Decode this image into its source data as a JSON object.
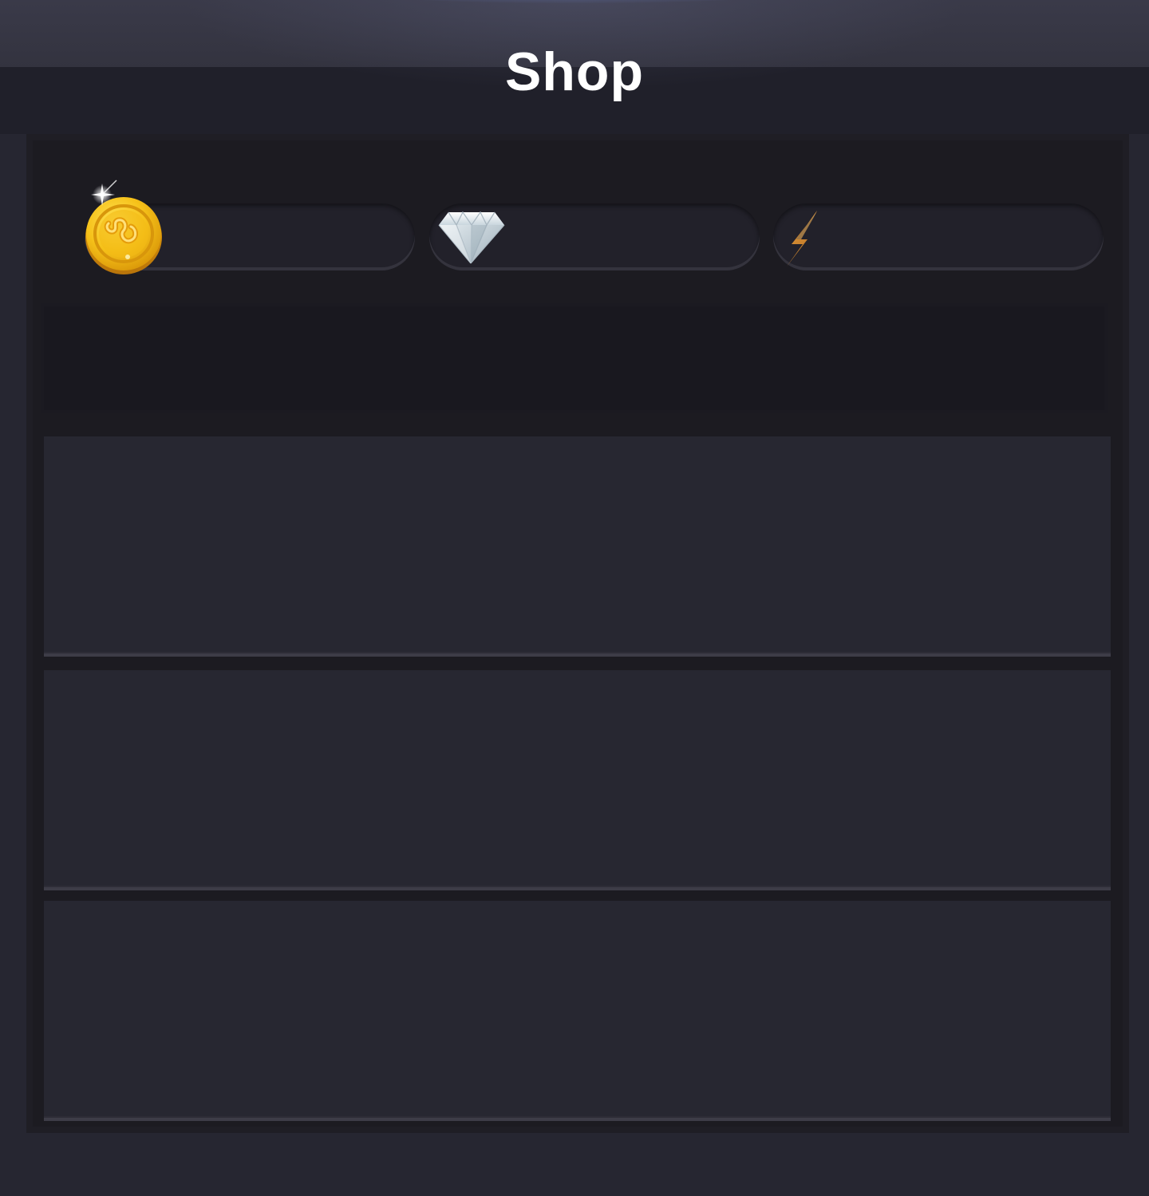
{
  "header": {
    "title": "Shop"
  },
  "currencies": [
    {
      "name": "coins",
      "icon": "gold-coin-icon",
      "value": ""
    },
    {
      "name": "gems",
      "icon": "diamond-icon",
      "value": ""
    },
    {
      "name": "energy",
      "icon": "lightning-bolt-icon",
      "value": ""
    }
  ],
  "banner": {
    "text": ""
  },
  "shop_items": [
    {
      "label": ""
    },
    {
      "label": ""
    },
    {
      "label": ""
    }
  ],
  "colors": {
    "background": "#262631",
    "header": "#20202a",
    "panel": "#1c1b21",
    "currency_pill": "#22212a",
    "shop_item": "#272731",
    "coin": "#f2b60d",
    "bolt": "#c9812c",
    "diamond": "#dfe8ee"
  }
}
